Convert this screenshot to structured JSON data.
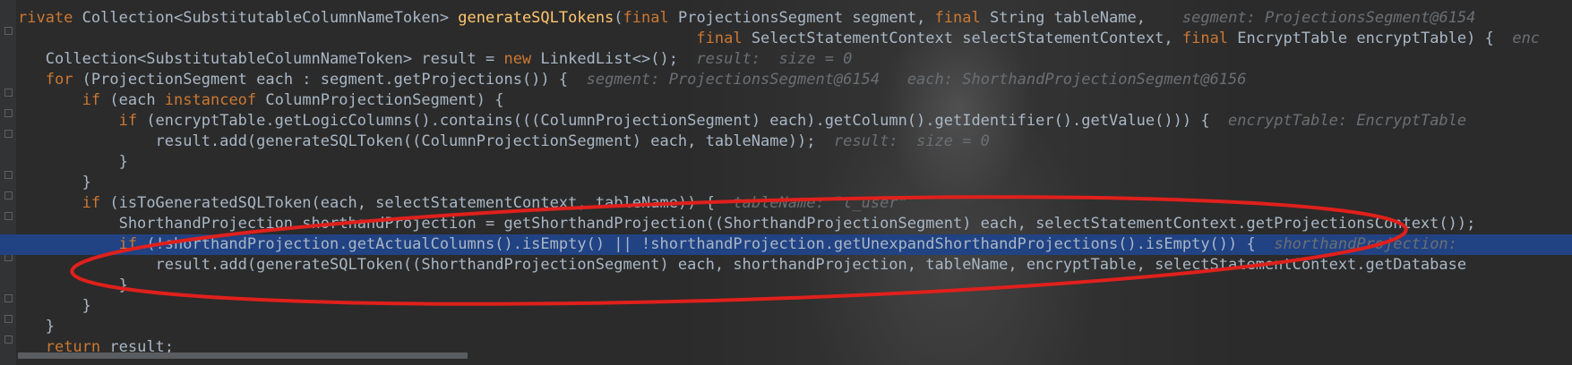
{
  "code_lines": [
    {
      "id": "l1",
      "segments": [
        {
          "t": "rivate ",
          "c": "kw"
        },
        {
          "t": "Collection<SubstitutableColumnNameToken> ",
          "c": "type"
        },
        {
          "t": "generateSQLTokens",
          "c": "fn"
        },
        {
          "t": "(",
          "c": "par"
        },
        {
          "t": "final ",
          "c": "kw"
        },
        {
          "t": "ProjectionsSegment segment, ",
          "c": "type"
        },
        {
          "t": "final ",
          "c": "kw"
        },
        {
          "t": "String tableName,    ",
          "c": "type"
        },
        {
          "t": "segment: ProjectionsSegment@6154",
          "c": "hint"
        }
      ]
    },
    {
      "id": "l2",
      "segments": [
        {
          "t": "                                                                          ",
          "c": "type"
        },
        {
          "t": "final ",
          "c": "kw"
        },
        {
          "t": "SelectStatementContext selectStatementContext, ",
          "c": "type"
        },
        {
          "t": "final ",
          "c": "kw"
        },
        {
          "t": "EncryptTable encryptTable) {  ",
          "c": "type"
        },
        {
          "t": "enc",
          "c": "hint"
        }
      ]
    },
    {
      "id": "l3",
      "segments": [
        {
          "t": "   Collection<SubstitutableColumnNameToken> result = ",
          "c": "type"
        },
        {
          "t": "new ",
          "c": "kw"
        },
        {
          "t": "LinkedList<>();  ",
          "c": "type"
        },
        {
          "t": "result:  size = 0",
          "c": "hint"
        }
      ]
    },
    {
      "id": "l4",
      "segments": [
        {
          "t": "   ",
          "c": "type"
        },
        {
          "t": "for ",
          "c": "kw"
        },
        {
          "t": "(ProjectionSegment each : segment.getProjections()) {  ",
          "c": "type"
        },
        {
          "t": "segment: ProjectionsSegment@6154   each: ShorthandProjectionSegment@6156",
          "c": "hint"
        }
      ]
    },
    {
      "id": "l5",
      "segments": [
        {
          "t": "       ",
          "c": "type"
        },
        {
          "t": "if ",
          "c": "kw"
        },
        {
          "t": "(each ",
          "c": "type"
        },
        {
          "t": "instanceof ",
          "c": "kw"
        },
        {
          "t": "ColumnProjectionSegment) {",
          "c": "type"
        }
      ]
    },
    {
      "id": "l6",
      "segments": [
        {
          "t": "           ",
          "c": "type"
        },
        {
          "t": "if ",
          "c": "kw"
        },
        {
          "t": "(encryptTable.getLogicColumns().contains(((ColumnProjectionSegment) each).getColumn().getIdentifier().getValue())) {  ",
          "c": "type"
        },
        {
          "t": "encryptTable: EncryptTable",
          "c": "hint"
        }
      ]
    },
    {
      "id": "l7",
      "segments": [
        {
          "t": "               result.add(generateSQLToken((ColumnProjectionSegment) each, tableName));  ",
          "c": "type"
        },
        {
          "t": "result:  size = 0",
          "c": "hint"
        }
      ]
    },
    {
      "id": "l8",
      "segments": [
        {
          "t": "           }",
          "c": "type"
        }
      ]
    },
    {
      "id": "l9",
      "segments": [
        {
          "t": "       }",
          "c": "type"
        }
      ]
    },
    {
      "id": "l10",
      "segments": [
        {
          "t": "       ",
          "c": "type"
        },
        {
          "t": "if ",
          "c": "kw"
        },
        {
          "t": "(isToGeneratedSQLToken(each, selectStatementContext, tableName)) {  ",
          "c": "type"
        },
        {
          "t": "tableName: \"t_user\"",
          "c": "hint"
        }
      ]
    },
    {
      "id": "l11",
      "segments": [
        {
          "t": "           ShorthandProjection shorthandProjection = getShorthandProjection((ShorthandProjectionSegment) each, selectStatementContext.getProjectionsContext());",
          "c": "type"
        }
      ]
    },
    {
      "id": "l12",
      "segments": [
        {
          "t": "           ",
          "c": "type"
        },
        {
          "t": "if ",
          "c": "kw"
        },
        {
          "t": "(!shorthandProjection.getActualColumns().isEmpty() || !shorthandProjection.getUnexpandShorthandProjections().isEmpty()) {  ",
          "c": "type"
        },
        {
          "t": "shorthandProjection: ",
          "c": "hint"
        }
      ]
    },
    {
      "id": "l13",
      "segments": [
        {
          "t": "               result.add(generateSQLToken((ShorthandProjectionSegment) each, shorthandProjection, tableName, encryptTable, selectStatementContext.getDatabase",
          "c": "type"
        }
      ]
    },
    {
      "id": "l14",
      "segments": [
        {
          "t": "           }",
          "c": "type"
        }
      ]
    },
    {
      "id": "l15",
      "segments": [
        {
          "t": "       }",
          "c": "type"
        }
      ]
    },
    {
      "id": "l16",
      "segments": [
        {
          "t": "   }",
          "c": "type"
        }
      ]
    },
    {
      "id": "l17",
      "segments": [
        {
          "t": "   ",
          "c": "type"
        },
        {
          "t": "return ",
          "c": "kw"
        },
        {
          "t": "result;",
          "c": "type"
        }
      ]
    }
  ],
  "highlighted_line": "l12",
  "colors": {
    "background": "#2b2b2b",
    "keyword": "#cc7832",
    "function": "#ffc66d",
    "text": "#a9b7c6",
    "hint": "#6b6f73",
    "selection": "#214283",
    "annotation": "#e0201c"
  }
}
